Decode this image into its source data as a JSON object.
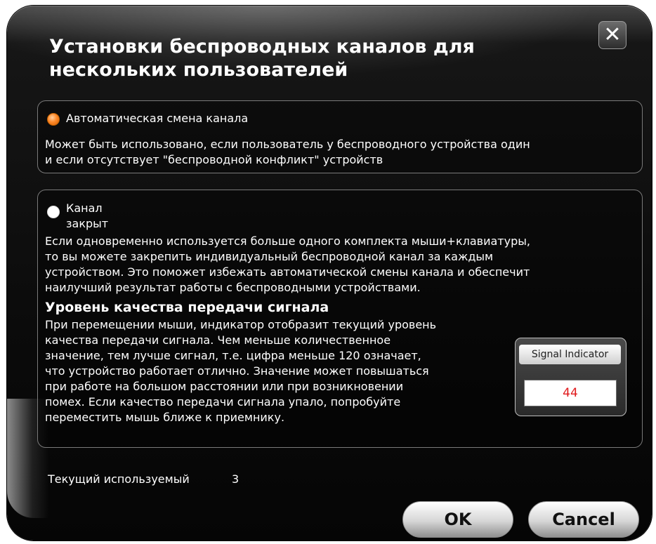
{
  "dialog": {
    "title_line1": "Установки беспроводных каналов для",
    "title_line2": "нескольких пользователей",
    "close_glyph": "✕"
  },
  "options": {
    "auto": {
      "selected": true,
      "label": "Автоматическая смена канала",
      "desc_line1": "Может быть использовано, если пользователь у беспроводного устройства один",
      "desc_line2": "и если отсутствует \"беспроводной конфликт\" устройств"
    },
    "closed": {
      "selected": false,
      "label_line1": "Канал",
      "label_line2": "закрыт",
      "desc_line1": "Если одновременно используется больше одного комплекта мыши+клавиатуры,",
      "desc_line2": "то вы можете закрепить индивидуальный беспроводной канал за каждым",
      "desc_line3": "устройством. Это поможет избежать автоматической смены канала и обеспечит",
      "desc_line4": "наилучший результат работы с беспроводными устройствами."
    }
  },
  "signal": {
    "heading": "Уровень качества передачи сигнала",
    "text_line1": "При перемещении мыши, индикатор отобразит текущий уровень",
    "text_line2": "качества передачи сигнала. Чем меньше количественное",
    "text_line3": "значение, тем лучше сигнал, т.е. цифра меньше 120 означает,",
    "text_line4": "что устройство работает отлично. Значение может повышаться",
    "text_line5": "при работе на большом расстоянии или при возникновении",
    "text_line6": "помех. Если качество передачи сигнала упало, попробуйте",
    "text_line7": "переместить мышь ближе к приемнику.",
    "indicator_label": "Signal Indicator",
    "indicator_value": "44",
    "value_color": "#e0191c"
  },
  "current": {
    "label": "Текущий используемый",
    "value": "3"
  },
  "buttons": {
    "ok": "OK",
    "cancel": "Cancel"
  },
  "colors": {
    "accent_radio": "#ff8a2a",
    "background": "#0b0b0b",
    "text": "#ffffff"
  }
}
